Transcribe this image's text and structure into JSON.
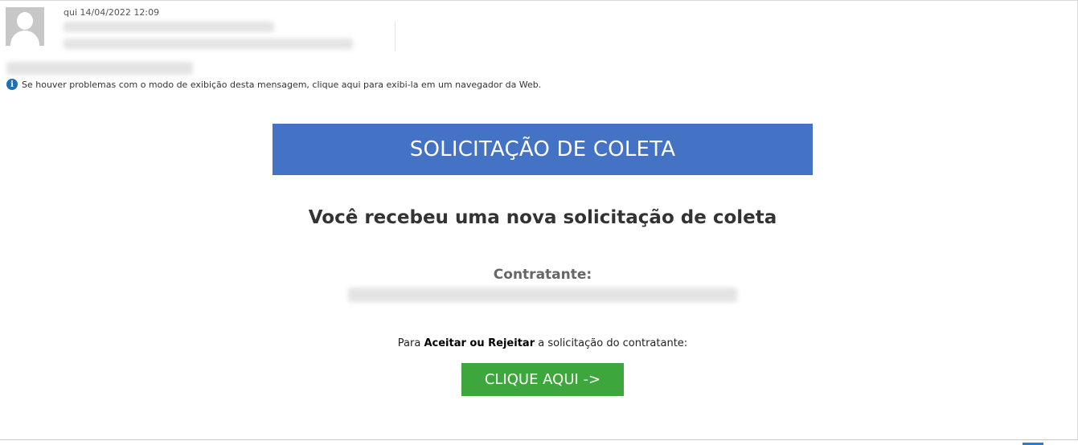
{
  "header": {
    "datetime": "qui 14/04/2022 12:09"
  },
  "info_bar": {
    "icon": "info-icon",
    "text": "Se houver problemas com o modo de exibição desta mensagem, clique aqui para exibi-la em um navegador da Web."
  },
  "email_body": {
    "banner_title": "SOLICITAÇÃO DE COLETA",
    "headline": "Você recebeu uma nova solicitação de coleta",
    "contractor_label": "Contratante:",
    "prompt_prefix": "Para ",
    "prompt_bold": "Aceitar ou Rejeitar",
    "prompt_suffix": " a solicitação do contratante:",
    "cta_label": "CLIQUE AQUI ->"
  },
  "colors": {
    "banner": "#4472c4",
    "cta": "#3da63d",
    "info_icon": "#1f6fb2"
  }
}
